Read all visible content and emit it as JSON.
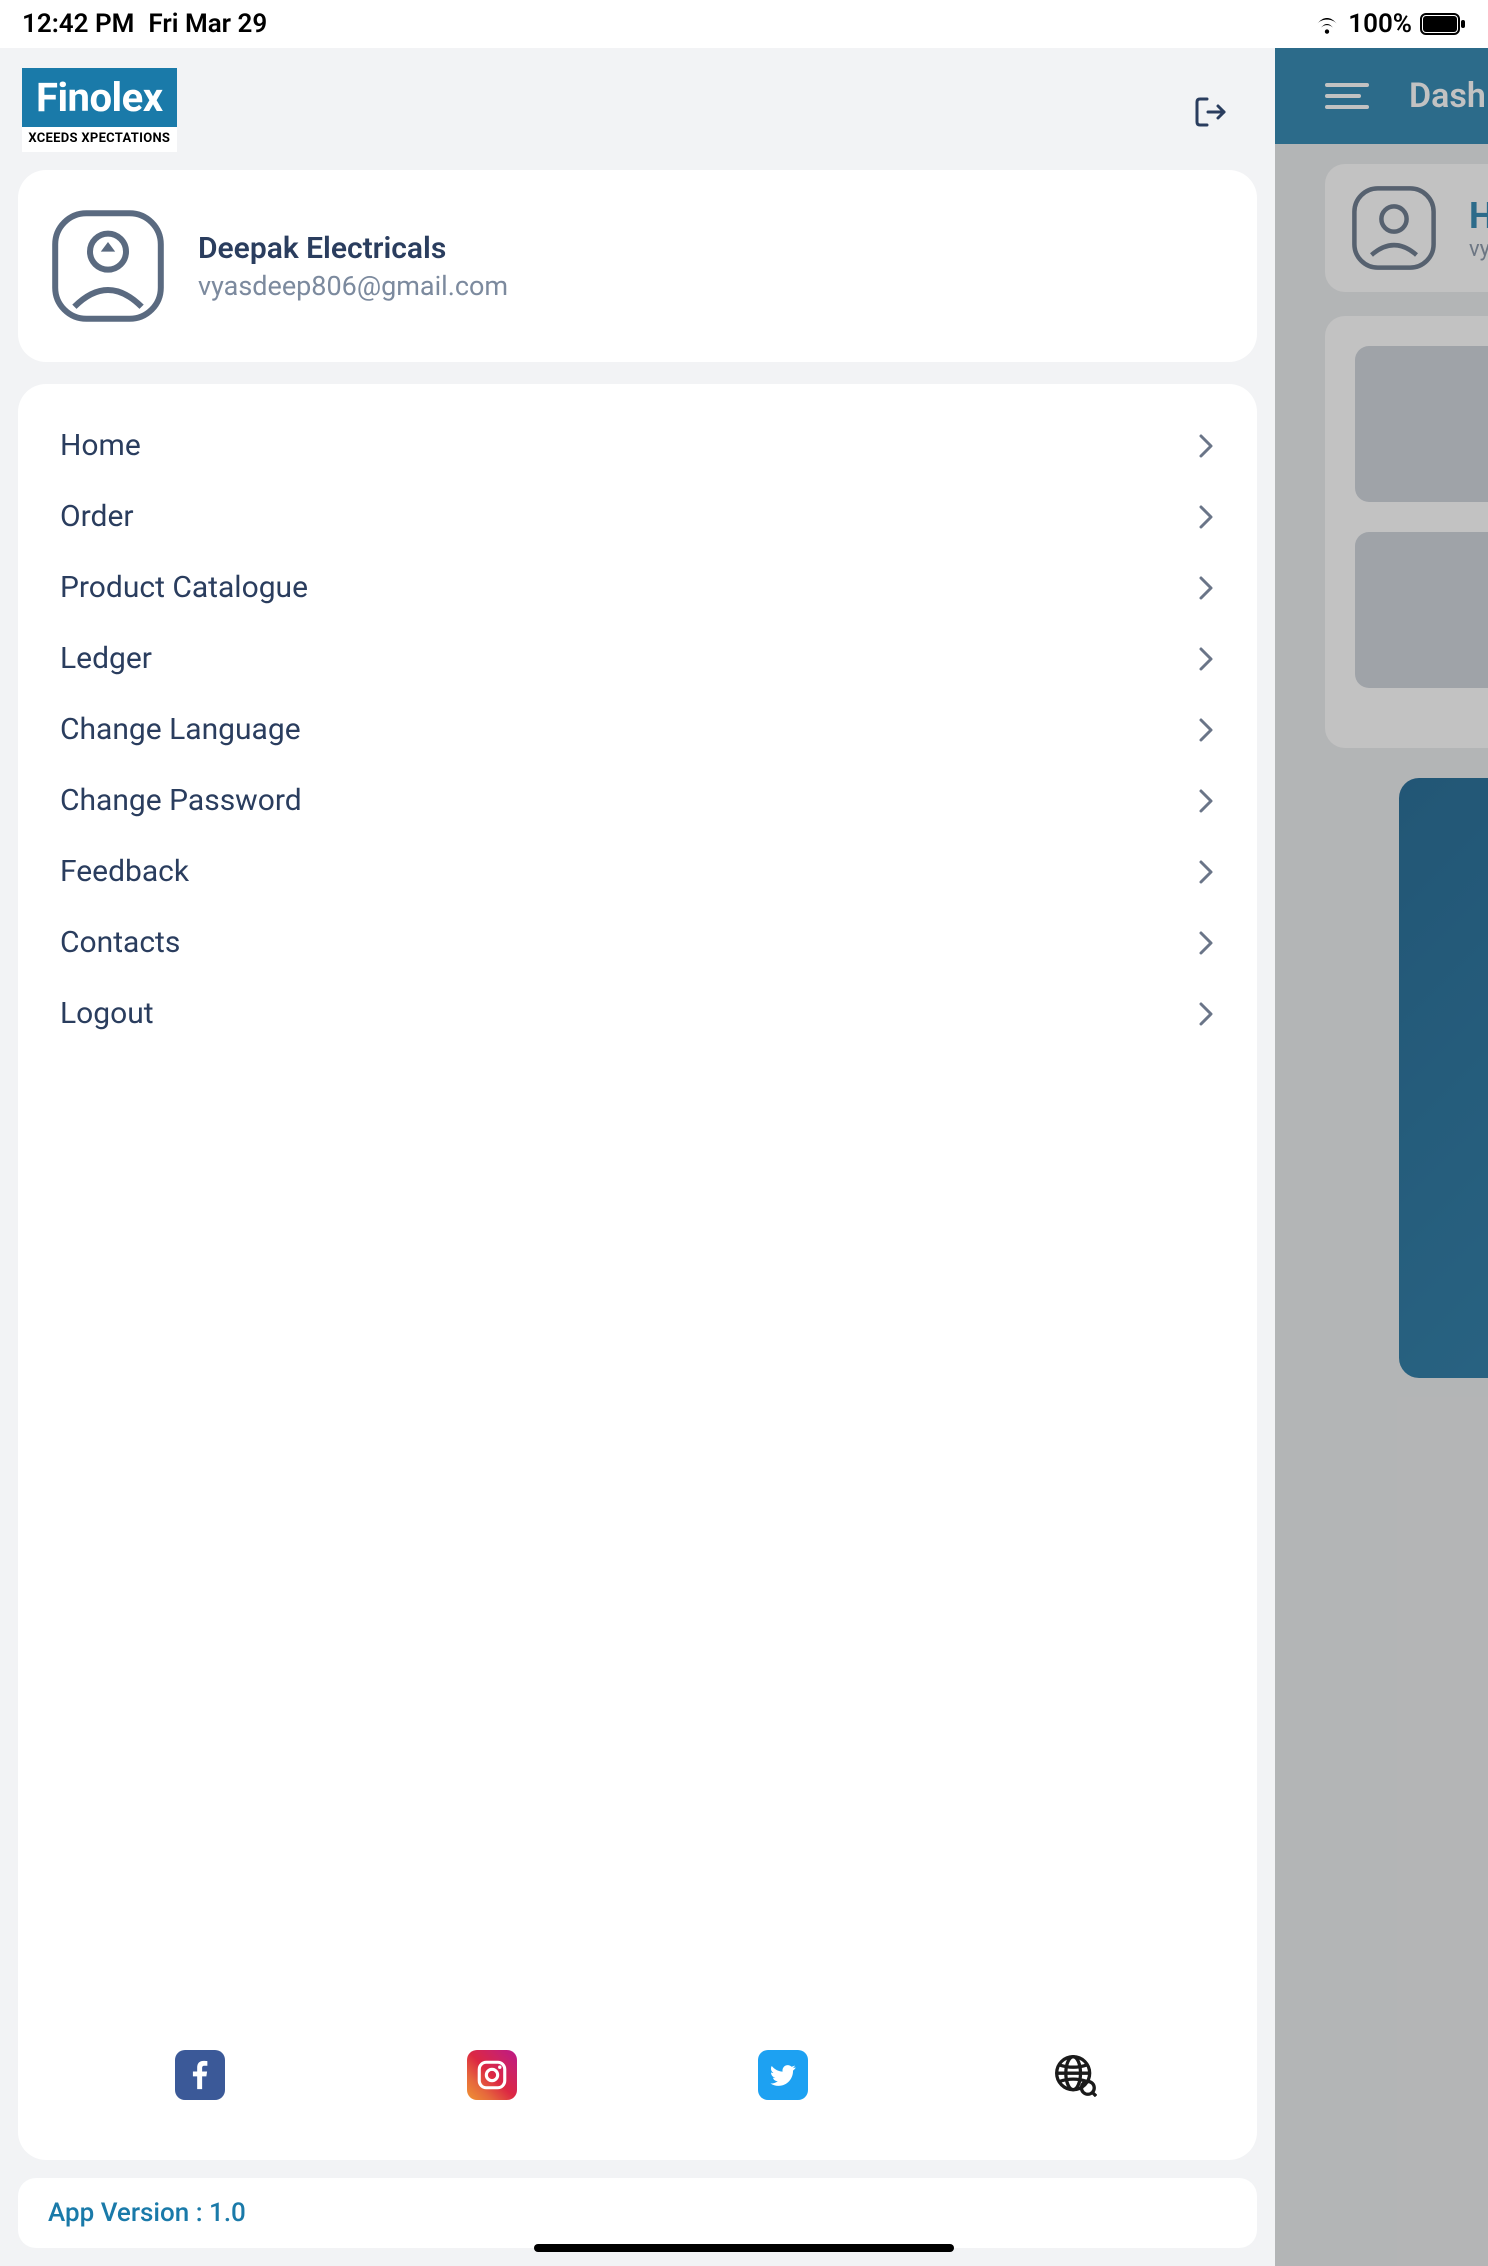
{
  "status": {
    "time": "12:42 PM",
    "date": "Fri Mar 29",
    "battery": "100%"
  },
  "brand": {
    "name": "Finolex",
    "tagline": "XCEEDS XPECTATIONS"
  },
  "user": {
    "name": "Deepak Electricals",
    "email": "vyasdeep806@gmail.com"
  },
  "menu": {
    "items": [
      {
        "label": "Home"
      },
      {
        "label": "Order"
      },
      {
        "label": "Product Catalogue"
      },
      {
        "label": "Ledger"
      },
      {
        "label": "Change Language"
      },
      {
        "label": "Change Password"
      },
      {
        "label": "Feedback"
      },
      {
        "label": "Contacts"
      },
      {
        "label": "Logout"
      }
    ]
  },
  "version": {
    "label": "App Version : 1.0"
  },
  "dashboard": {
    "title": "Dash",
    "greeting": "Hi",
    "email_prefix": "vya"
  }
}
